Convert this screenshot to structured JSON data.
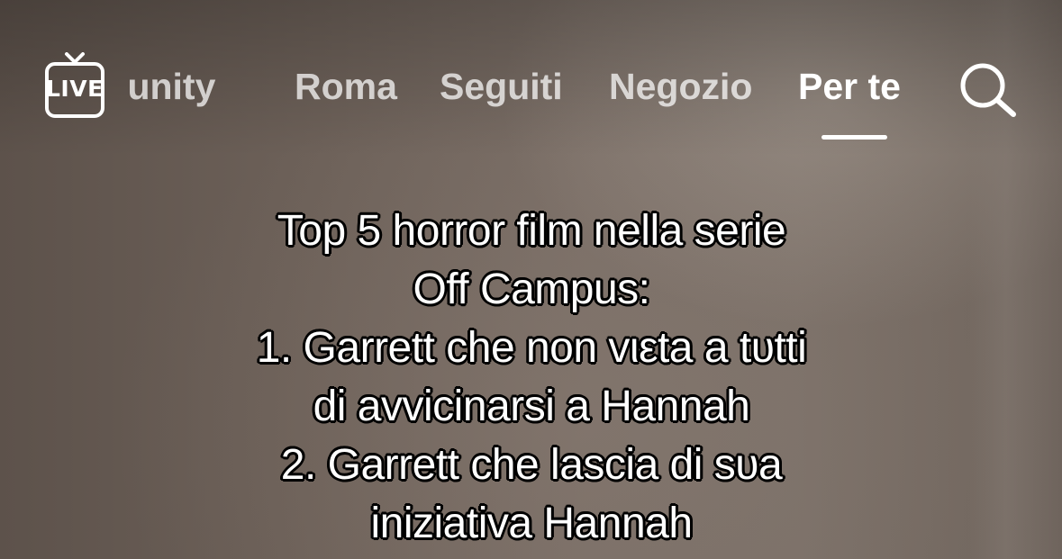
{
  "top_nav": {
    "live_label": "LIVE",
    "tabs": [
      {
        "label": "munity",
        "active": false
      },
      {
        "label": "Roma",
        "active": false
      },
      {
        "label": "Seguiti",
        "active": false
      },
      {
        "label": "Negozio",
        "active": false
      },
      {
        "label": "Per te",
        "active": true
      }
    ],
    "live_icon": "live-tv-icon",
    "search_icon": "search-icon"
  },
  "caption": {
    "lines": [
      "Top 5 horror film nella serie",
      "Off Campus:",
      "1. Garrett che non vιεta a tυtti",
      "di avvicinarsi a Hannah",
      "2. Garrett che lascia di sυa",
      "iniziativa Hannah"
    ]
  },
  "colors": {
    "text": "#ffffff",
    "inactive_tab": "rgba(255,255,255,0.72)",
    "caption_outline": "#000000",
    "background": "#6b5e55"
  }
}
